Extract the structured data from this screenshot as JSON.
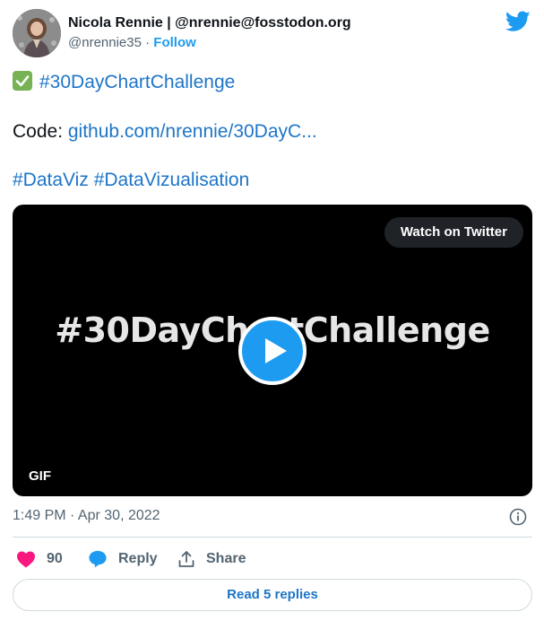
{
  "author": {
    "display_name": "Nicola Rennie | @nrennie@fosstodon.org",
    "handle": "@nrennie35",
    "separator": " · ",
    "follow_label": "Follow"
  },
  "tweet": {
    "hashtag_line": "#30DayChartChallenge",
    "code_prefix": "Code: ",
    "code_link": "github.com/nrennie/30DayC...",
    "tags": [
      "#DataViz",
      "#DataVizualisation"
    ]
  },
  "media": {
    "watch_label": "Watch on Twitter",
    "overlay_text": "#30DayChartChallenge",
    "badge": "GIF"
  },
  "meta": {
    "timestamp": "1:49 PM · Apr 30, 2022"
  },
  "actions": {
    "like_count": "90",
    "reply_label": "Reply",
    "share_label": "Share"
  },
  "replies_button": "Read 5 replies",
  "colors": {
    "accent": "#1d9bf0",
    "link": "#1d75c8",
    "like": "#f91880",
    "check": "#77b255",
    "muted": "#536471"
  }
}
